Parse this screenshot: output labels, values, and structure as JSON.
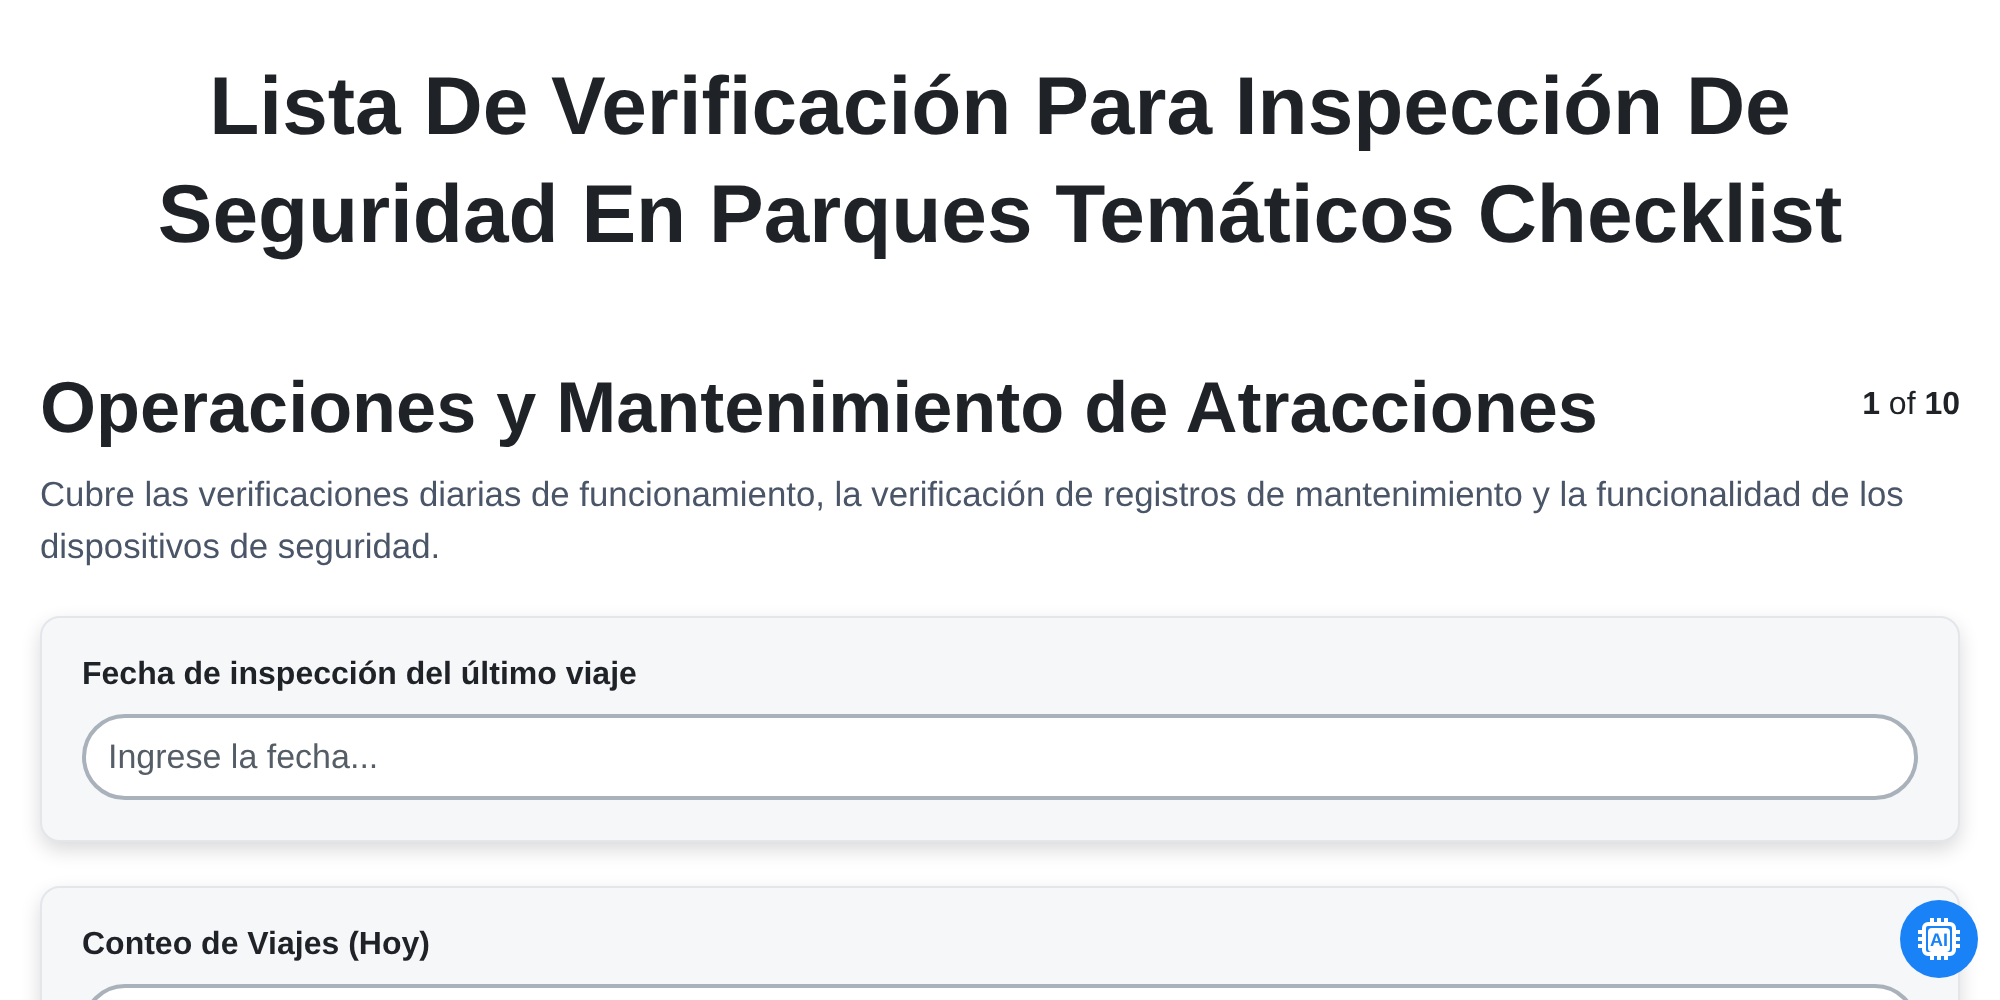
{
  "title": "Lista De Verificación Para Inspección De Seguridad En Parques Temáticos Checklist",
  "section": {
    "heading": "Operaciones y Mantenimiento de Atracciones",
    "pager": "**1** of **10**",
    "description": "Cubre las verificaciones diarias de funcionamiento, la verificación de registros de mantenimiento y la funcionalidad de los dispositivos de seguridad."
  },
  "fields": [
    {
      "label": "Fecha de inspección del último viaje",
      "placeholder": "Ingrese la fecha..."
    },
    {
      "label": "Conteo de Viajes (Hoy)"
    }
  ],
  "ai_button": {
    "label": "AI"
  }
}
